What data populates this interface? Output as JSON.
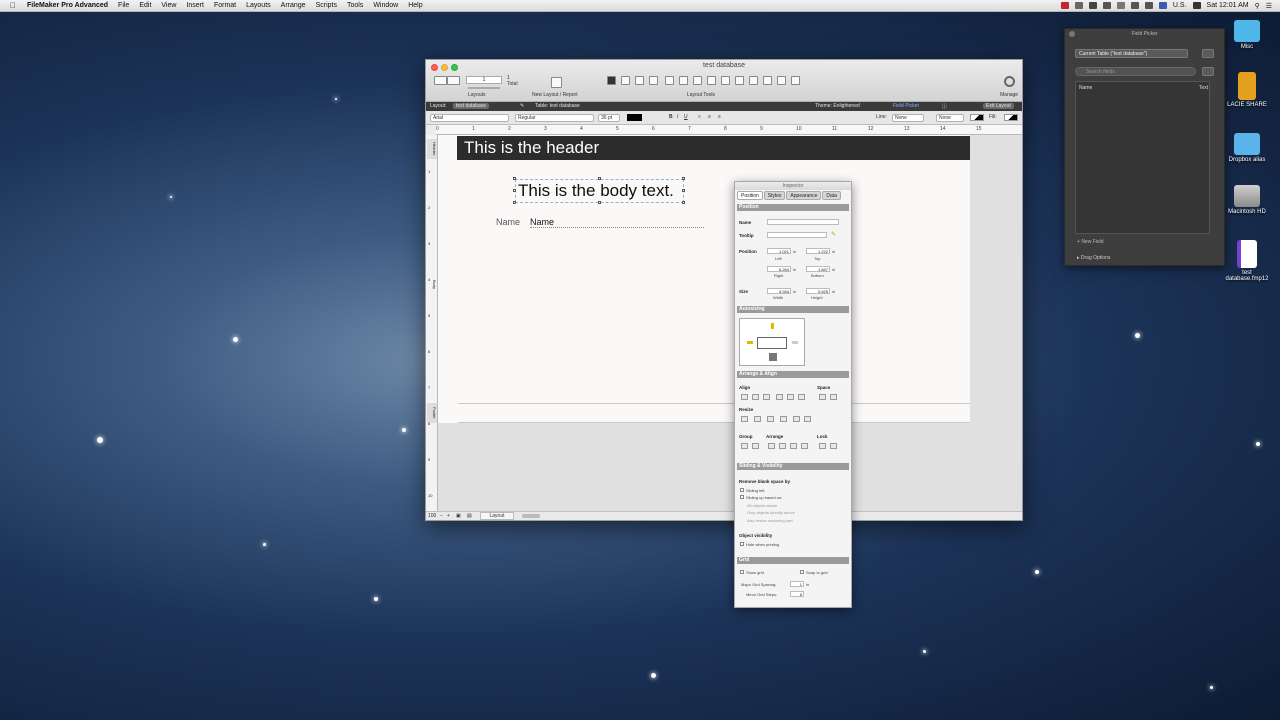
{
  "menubar": {
    "app_name": "FileMaker Pro Advanced",
    "items": [
      "File",
      "Edit",
      "View",
      "Insert",
      "Format",
      "Layouts",
      "Arrange",
      "Scripts",
      "Tools",
      "Window",
      "Help"
    ],
    "input_source": "U.S.",
    "clock": "Sat 12:01 AM"
  },
  "window": {
    "title": "test database",
    "toolbar": {
      "record_count": "1",
      "total_label": "Total",
      "layouts_label": "Layouts",
      "new_layout_label": "New Layout / Report",
      "layout_tools_label": "Layout Tools",
      "manage_label": "Manage"
    },
    "layout_bar": {
      "layout_label": "Layout:",
      "layout_value": "test database",
      "table_label": "Table: test database",
      "theme_label": "Theme: Enlightened",
      "field_picker_label": "Field Picker",
      "exit_layout_label": "Exit Layout"
    },
    "format_bar": {
      "font": "Arial",
      "style": "Regular",
      "size": "36 pt",
      "line_label": "Line:",
      "line_value": "None",
      "line_value2": "None",
      "fill_label": "Fill:"
    },
    "ruler_ticks": [
      "0",
      "1",
      "2",
      "3",
      "4",
      "5",
      "6",
      "7",
      "8",
      "9",
      "10",
      "11",
      "12",
      "13",
      "14",
      "15"
    ],
    "vruler_ticks": [
      "1",
      "2",
      "3",
      "4",
      "5",
      "6",
      "7",
      "8",
      "9",
      "10"
    ],
    "canvas": {
      "header_text": "This is the header",
      "body_text": "This is the body text.",
      "name_label": "Name",
      "name_field": "Name",
      "part_header": "Header",
      "part_body": "Body",
      "part_footer": "Footer"
    },
    "status": {
      "zoom": "100",
      "mode": "Layout"
    }
  },
  "inspector": {
    "title": "Inspector",
    "tabs": [
      "Position",
      "Styles",
      "Appearance",
      "Data"
    ],
    "position": {
      "section_title": "Position",
      "name_label": "Name",
      "tooltip_label": "Tooltip",
      "position_label": "Position",
      "left_value": "1.021",
      "top_value": "1.222",
      "right_value": "6.264",
      "bottom_value": "1.847",
      "left_label": "Left",
      "top_label": "Top",
      "right_label": "Right",
      "bottom_label": "Bottom",
      "unit": "in",
      "size_label": "Size",
      "width_value": "4.944",
      "height_value": "0.625",
      "width_label": "Width",
      "height_label": "Height"
    },
    "autosizing": {
      "section_title": "Autosizing"
    },
    "arrange": {
      "section_title": "Arrange & Align",
      "align_label": "Align",
      "space_label": "Space",
      "resize_label": "Resize",
      "group_label": "Group",
      "arrange_label": "Arrange",
      "lock_label": "Lock"
    },
    "sliding": {
      "section_title": "Sliding & Visibility",
      "remove_blank_label": "Remove blank space by",
      "sliding_left": "Sliding left",
      "sliding_up": "Sliding up based on:",
      "opt_all_above": "All objects above",
      "opt_directly_above": "Only objects directly above",
      "opt_enclosing": "Also resize enclosing part",
      "object_visibility_label": "Object visibility",
      "hide_when_printing": "Hide when printing"
    },
    "grid": {
      "section_title": "Grid",
      "show_grid": "Show grid",
      "snap_to_grid": "Snap to grid",
      "major_spacing_label": "Major Grid Spacing:",
      "major_spacing_value": "1",
      "major_unit": "in",
      "minor_steps_label": "Minor Grid Steps:",
      "minor_steps_value": "8"
    }
  },
  "field_picker": {
    "title": "Field Picker",
    "table_select": "Current Table (\"test database\")",
    "search_placeholder": "Search fields",
    "col_name": "Name",
    "col_type": "Text",
    "new_field": "New Field",
    "drag_options": "Drag Options"
  },
  "desktop": {
    "icons": [
      "Misc",
      "LACIE SHARE",
      "Dropbox alias",
      "Macintosh HD",
      "test database.fmp12"
    ]
  }
}
